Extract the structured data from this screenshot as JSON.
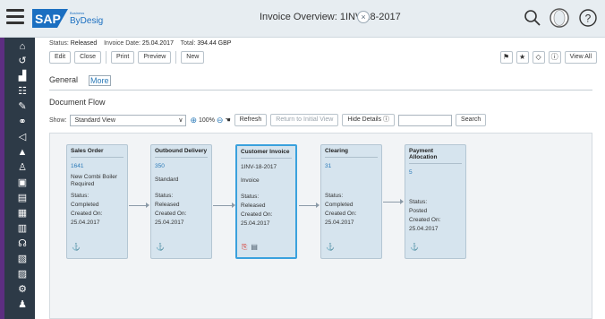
{
  "shell": {
    "logo_main": "SAP",
    "logo_sub_small": "Business",
    "logo_sub": "ByDesign",
    "window_title": "Invoice Overview: 1INV-18-2017",
    "close_glyph": "×",
    "icons": [
      "search-icon",
      "user-avatar-icon",
      "help-icon"
    ]
  },
  "header": {
    "status_label": "Status:",
    "status_value": "Released",
    "invoice_date_label": "Invoice Date:",
    "invoice_date_value": "25.04.2017",
    "total_label": "Total:",
    "total_value": "394.44 GBP"
  },
  "toolbar": {
    "edit": "Edit",
    "close": "Close",
    "print": "Print",
    "preview": "Preview",
    "new": "New"
  },
  "right_toolbar": {
    "view_all": "View All",
    "icons": [
      "flag-icon",
      "star-icon",
      "tag-icon",
      "info-icon"
    ]
  },
  "tabs": {
    "general": "General",
    "more": "More"
  },
  "document_flow": {
    "title": "Document Flow",
    "show_label": "Show:",
    "view_select": "Standard View",
    "zoom": "100%",
    "refresh": "Refresh",
    "return_initial": "Return to Initial View",
    "hide_details": "Hide Details",
    "search_button": "Search",
    "cards": [
      {
        "title": "Sales Order",
        "id": "1641",
        "description": "New Combi Boiler Required",
        "status_label": "Status:",
        "status": "Completed",
        "created_label": "Created On:",
        "created": "25.04.2017"
      },
      {
        "title": "Outbound Delivery",
        "id": "350",
        "description": "Standard",
        "status_label": "Status:",
        "status": "Released",
        "created_label": "Created On:",
        "created": "25.04.2017"
      },
      {
        "title": "Customer Invoice",
        "id": "1INV-18-2017",
        "description": "Invoice",
        "status_label": "Status:",
        "status": "Released",
        "created_label": "Created On:",
        "created": "25.04.2017"
      },
      {
        "title": "Clearing",
        "id": "31",
        "description": "",
        "status_label": "Status:",
        "status": "Completed",
        "created_label": "Created On:",
        "created": "25.04.2017"
      },
      {
        "title": "Payment Allocation",
        "id": "5",
        "description": "",
        "status_label": "Status:",
        "status": "Posted",
        "created_label": "Created On:",
        "created": "25.04.2017"
      }
    ]
  },
  "colors": {
    "accent": "#3aa1dd",
    "sidebar": "#2d3a47",
    "card_bg": "#d6e4ee",
    "link": "#2b7ab8"
  }
}
